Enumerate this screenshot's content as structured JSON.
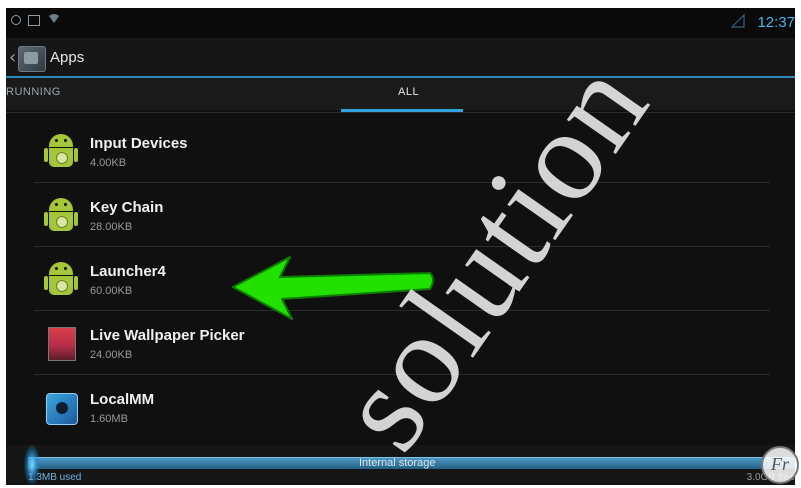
{
  "status_bar": {
    "time": "12:37"
  },
  "action_bar": {
    "back": "‹",
    "title": "Apps"
  },
  "tabs": [
    {
      "label": "RUNNING",
      "selected": false
    },
    {
      "label": "ALL",
      "selected": true
    }
  ],
  "apps": [
    {
      "name": "Input Devices",
      "size": "4.00KB",
      "icon": "android-icon"
    },
    {
      "name": "Key Chain",
      "size": "28.00KB",
      "icon": "android-icon"
    },
    {
      "name": "Launcher4",
      "size": "60.00KB",
      "icon": "android-icon"
    },
    {
      "name": "Live Wallpaper Picker",
      "size": "24.00KB",
      "icon": "wallpaper-icon"
    },
    {
      "name": "LocalMM",
      "size": "1.60MB",
      "icon": "localmm-icon"
    }
  ],
  "storage": {
    "label": "Internal storage",
    "used": "1.3MB used",
    "free": "3.0GB free"
  },
  "colors": {
    "accent": "#33a2dd",
    "android_green": "#a4c639",
    "arrow_green": "#22e000"
  },
  "watermark": {
    "text": "solution",
    "logo": "Fr"
  }
}
